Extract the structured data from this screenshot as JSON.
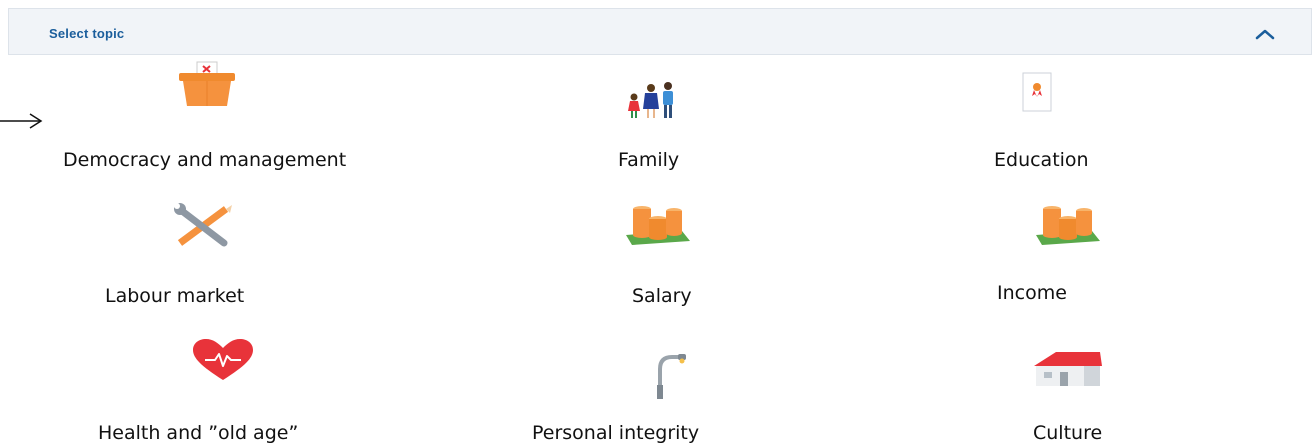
{
  "header": {
    "title": "Select topic",
    "collapse_icon": "chevron-up-icon",
    "accent": "#1b5e9c"
  },
  "pointer": {
    "icon": "arrow-right-icon"
  },
  "topics": [
    {
      "label": "Democracy and management",
      "icon": "ballot-box-icon"
    },
    {
      "label": "Family",
      "icon": "family-icon"
    },
    {
      "label": "Education",
      "icon": "diploma-icon"
    },
    {
      "label": "Labour market",
      "icon": "tools-icon"
    },
    {
      "label": "Salary",
      "icon": "coins-icon"
    },
    {
      "label": "Income",
      "icon": "coins-icon"
    },
    {
      "label": "Health and ”old age”",
      "icon": "heart-pulse-icon"
    },
    {
      "label": "Personal integrity",
      "icon": "street-lamp-icon"
    },
    {
      "label": "Culture",
      "icon": "house-icon"
    }
  ],
  "colors": {
    "orange": "#f5923e",
    "red": "#e8333a",
    "green": "#5aa84a",
    "gray": "#9aa3ab",
    "blue": "#2f6fb3"
  }
}
